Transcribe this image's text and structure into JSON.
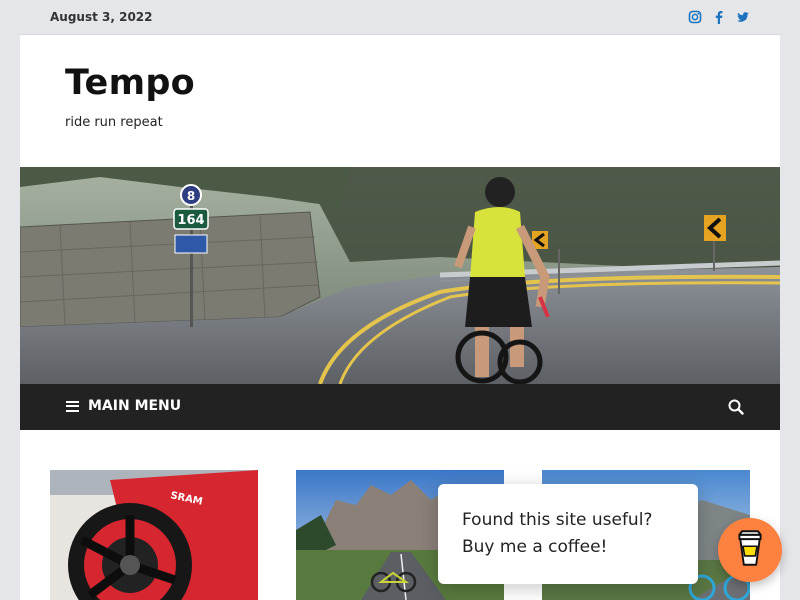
{
  "topbar": {
    "date": "August 3, 2022",
    "social_icons": [
      "instagram-icon",
      "facebook-icon",
      "twitter-icon"
    ]
  },
  "header": {
    "site_title": "Tempo",
    "tagline": "ride run repeat"
  },
  "hero": {
    "sign_route_top": "8",
    "sign_route_main": "164"
  },
  "nav": {
    "menu_label": "MAIN MENU",
    "icons": [
      "menu-icon",
      "search-icon"
    ]
  },
  "posts": {
    "thumb1_brand": "SRAM"
  },
  "popup": {
    "line1": "Found this site useful?",
    "line2": "Buy me a coffee!"
  },
  "colors": {
    "accent": "#1e73be",
    "nav_bg": "#222222",
    "coffee_button": "#ff813f",
    "page_bg": "#e4e6e9"
  }
}
